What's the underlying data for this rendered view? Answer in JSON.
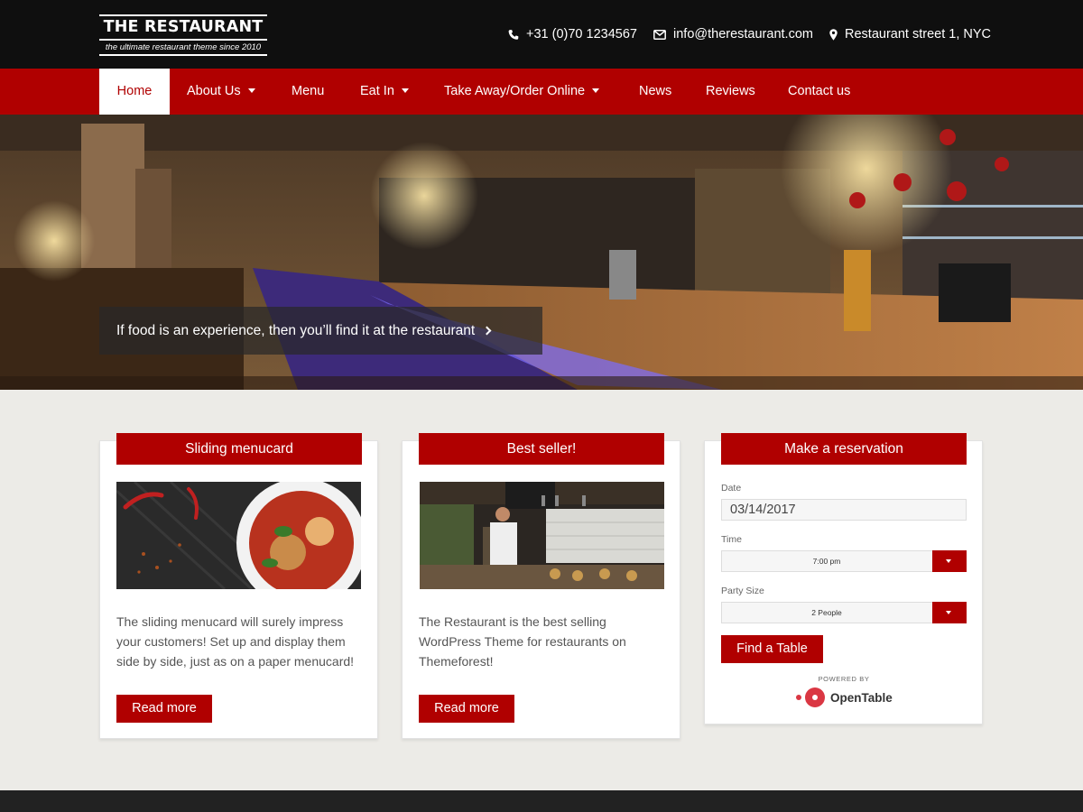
{
  "brand": {
    "title": "THE RESTAURANT",
    "tagline": "the ultimate restaurant theme since 2010"
  },
  "contact": {
    "phone": "+31 (0)70 1234567",
    "email": "info@therestaurant.com",
    "address": "Restaurant street 1, NYC"
  },
  "nav": {
    "home": "Home",
    "about": "About Us",
    "menu": "Menu",
    "eat_in": "Eat In",
    "take_away": "Take Away/Order Online",
    "news": "News",
    "reviews": "Reviews",
    "contact": "Contact us"
  },
  "hero": {
    "caption": "If food is an experience, then you’ll find it at the restaurant"
  },
  "cards": {
    "menucard": {
      "title": "Sliding menucard",
      "text": "The sliding menucard will surely impress your customers! Set up and display them side by side, just as on a paper menucard!",
      "button": "Read more"
    },
    "bestseller": {
      "title": "Best seller!",
      "text": "The Restaurant is the best selling WordPress Theme for restaurants on Themeforest!",
      "button": "Read more"
    },
    "reservation": {
      "title": "Make a reservation",
      "date_label": "Date",
      "date_value": "03/14/2017",
      "time_label": "Time",
      "time_value": "7:00 pm",
      "party_label": "Party Size",
      "party_value": "2 People",
      "button": "Find a Table",
      "powered_by": "POWERED BY",
      "provider": "OpenTable"
    }
  },
  "colors": {
    "accent": "#b00000",
    "topbar": "#0f0f0f",
    "page_bg": "#ecebe7",
    "opentable": "#da3743"
  },
  "icons": {
    "phone": "phone-icon",
    "email": "envelope-icon",
    "address": "map-pin-icon"
  }
}
